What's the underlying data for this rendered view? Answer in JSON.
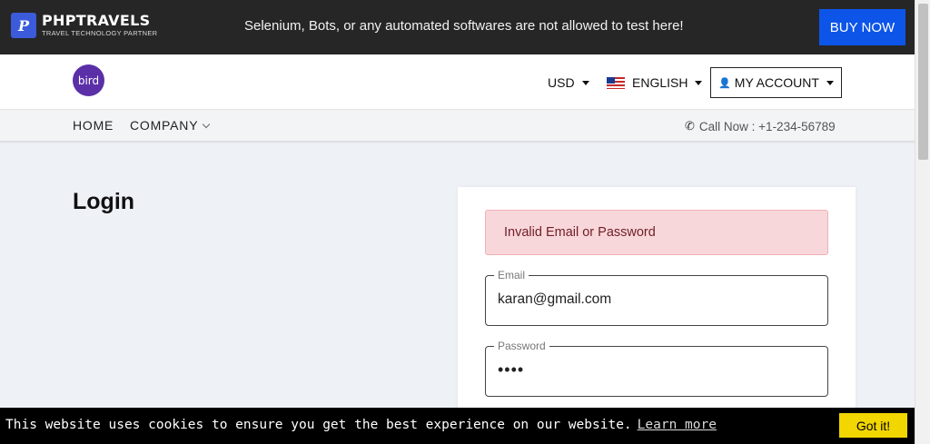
{
  "topbar": {
    "brand_mark": "P",
    "brand_name": "PHPTRAVELS",
    "brand_tagline": "TRAVEL TECHNOLOGY PARTNER",
    "notice": "Selenium, Bots, or any automated softwares are not allowed to test here!",
    "buy_label": "BUY NOW"
  },
  "navbar": {
    "logo_text": "bird",
    "currency": "USD",
    "language": "ENGLISH",
    "account_label": "MY ACCOUNT"
  },
  "menu": {
    "home": "HOME",
    "company": "COMPANY",
    "call": "Call Now : +1-234-56789"
  },
  "page": {
    "title": "Login"
  },
  "login_form": {
    "alert": "Invalid Email or Password",
    "email_label": "Email",
    "email_value": "karan@gmail.com",
    "password_label": "Password",
    "password_value": "••••"
  },
  "cookie": {
    "text": "This website uses cookies to ensure you get the best experience on our website.",
    "learn_more": "Learn more",
    "button": "Got it!"
  },
  "colors": {
    "accent": "#0d55e8",
    "alert_bg": "#f8d7da",
    "cookie_button": "#f1d600"
  }
}
